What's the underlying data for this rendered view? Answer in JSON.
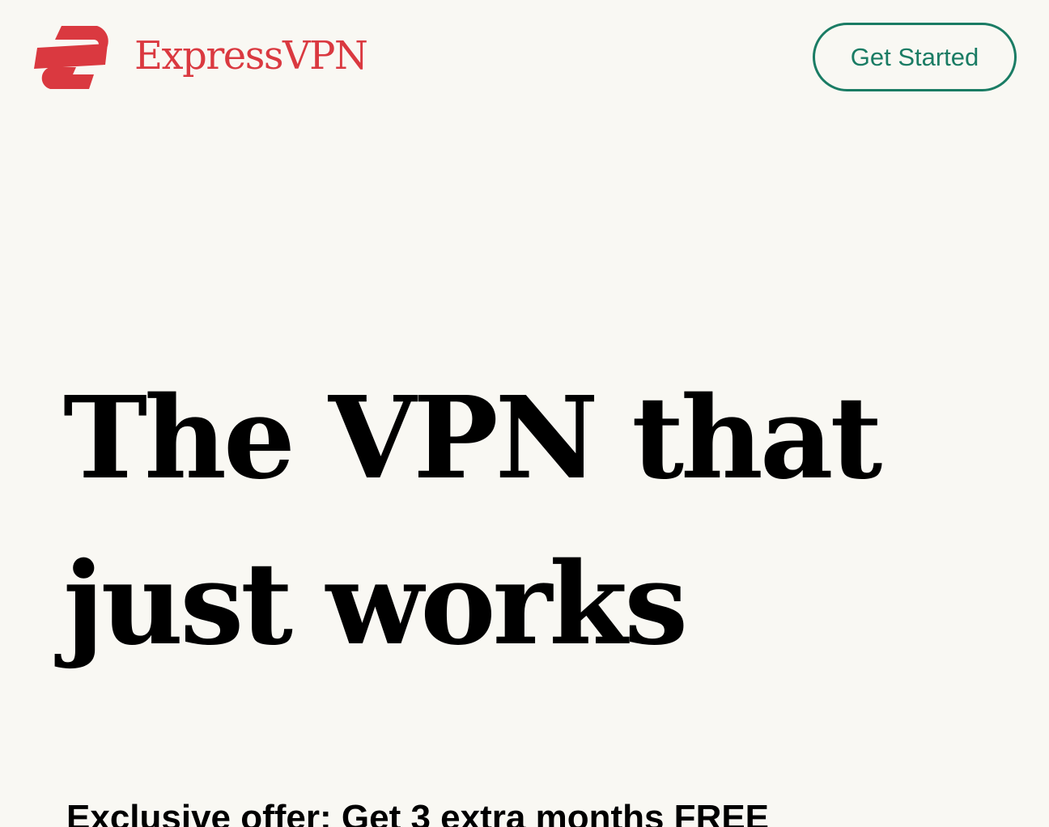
{
  "brand": {
    "name": "ExpressVPN",
    "logo_icon": "expressvpn-logo-icon",
    "color": "#da3940"
  },
  "header": {
    "cta_label": "Get Started",
    "cta_color": "#1a7c64"
  },
  "hero": {
    "title_line1": "The VPN that",
    "title_line2": "just works",
    "offer_text": "Exclusive offer: Get 3 extra months FREE"
  },
  "colors": {
    "background": "#f9f8f3",
    "text": "#000000"
  }
}
